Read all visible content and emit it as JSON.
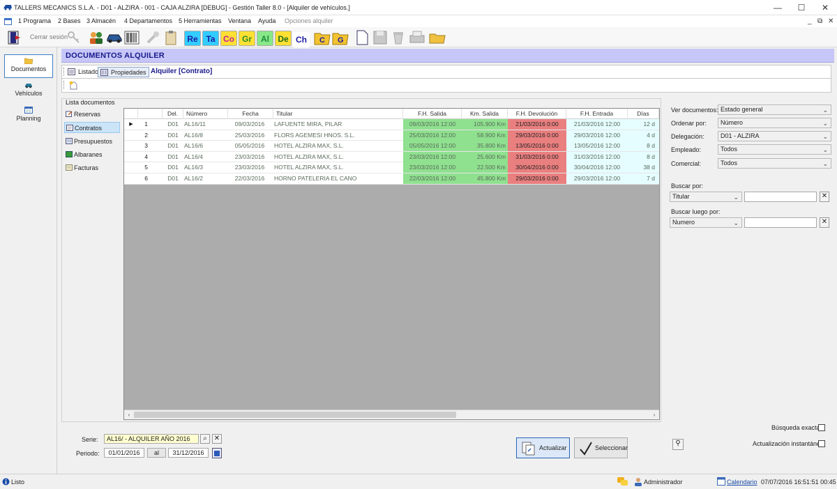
{
  "window": {
    "title": "TALLERS MECANICS S.L.A. - D01 - ALZIRA - 001 - CAJA ALZIRA [DEBUG] - Gestión Taller 8.0 - [Alquiler de vehículos.]",
    "minimize": "—",
    "maximize": "☐",
    "close": "✕"
  },
  "menu": {
    "items": [
      "1 Programa",
      "2 Bases",
      "3 Almacén",
      "4 Departamentos",
      "5 Herramientas",
      "Ventana",
      "Ayuda",
      "Opciones alquiler"
    ],
    "mdi_min": "_",
    "mdi_restore": "⧉",
    "mdi_close": "✕"
  },
  "toolbar": {
    "logout_label": "Cerrar sesión",
    "text_buttons": [
      "Re",
      "Ta",
      "Co",
      "Gr",
      "Al",
      "De",
      "Ch"
    ],
    "text_colors": [
      "#1a1aa0",
      "#1a1aa0",
      "#c81a9a",
      "#2a8a2a",
      "#1a8a3a",
      "#1a6a1a",
      "#1a1aa0"
    ],
    "text_bgs": [
      "#33ccff",
      "#33ccff",
      "#ffe033",
      "#ffe033",
      "#88e888",
      "#ffe033",
      "#ffffff"
    ]
  },
  "nav": {
    "items": [
      {
        "label": "Documentos",
        "icon": "folder-icon"
      },
      {
        "label": "Vehículos",
        "icon": "car-icon"
      },
      {
        "label": "Planning",
        "icon": "calendar-icon"
      }
    ]
  },
  "header": {
    "title": "DOCUMENTOS ALQUILER"
  },
  "tabs": {
    "listado": "Listado",
    "propiedades": "Propiedades",
    "doc_title": "Alquiler [Contrato]"
  },
  "list": {
    "group_label": "Lista documentos",
    "categories": [
      "Reservas",
      "Contratos",
      "Presupuestos",
      "Albaranes",
      "Facturas"
    ]
  },
  "grid": {
    "columns": [
      "Del.",
      "Número",
      "Fecha",
      "Titular",
      "F.H. Salida",
      "Km. Salida",
      "F.H. Devolución",
      "F.H. Entrada",
      "Días"
    ],
    "rows": [
      {
        "n": "1",
        "del": "D01",
        "numero": "AL16/11",
        "fecha": "09/03/2016",
        "titular": "LAFUENTE MIRA, PILAR",
        "fh_salida": "09/03/2016 12:00",
        "km_salida": "105.900 Km",
        "fh_devolucion": "21/03/2016 0:00",
        "fh_entrada": "21/03/2016 12:00",
        "dias": "12 d"
      },
      {
        "n": "2",
        "del": "D01",
        "numero": "AL16/8",
        "fecha": "25/03/2016",
        "titular": "FLORS AGEMESI HNOS. S.L.",
        "fh_salida": "25/03/2016 12:00",
        "km_salida": "58.900 Km",
        "fh_devolucion": "29/03/2016 0:00",
        "fh_entrada": "29/03/2016 12:00",
        "dias": "4 d"
      },
      {
        "n": "3",
        "del": "D01",
        "numero": "AL16/6",
        "fecha": "05/05/2016",
        "titular": "HOTEL ALZIRA MAX, S.L.",
        "fh_salida": "05/05/2016 12:00",
        "km_salida": "35.800 Km",
        "fh_devolucion": "13/05/2016 0:00",
        "fh_entrada": "13/05/2016 12:00",
        "dias": "8 d"
      },
      {
        "n": "4",
        "del": "D01",
        "numero": "AL16/4",
        "fecha": "23/03/2016",
        "titular": "HOTEL ALZIRA MAX, S.L.",
        "fh_salida": "23/03/2016 12:00",
        "km_salida": "25.600 Km",
        "fh_devolucion": "31/03/2016 0:00",
        "fh_entrada": "31/03/2016 12:00",
        "dias": "8 d"
      },
      {
        "n": "5",
        "del": "D01",
        "numero": "AL16/3",
        "fecha": "23/03/2016",
        "titular": "HOTEL ALZIRA MAX, S.L.",
        "fh_salida": "23/03/2016 12:00",
        "km_salida": "22.500 Km",
        "fh_devolucion": "30/04/2016 0:00",
        "fh_entrada": "30/04/2016 12:00",
        "dias": "38 d"
      },
      {
        "n": "6",
        "del": "D01",
        "numero": "AL16/2",
        "fecha": "22/03/2016",
        "titular": "HORNO PATELERIA EL CANO",
        "fh_salida": "22/03/2016 12:00",
        "km_salida": "45.800 Km",
        "fh_devolucion": "29/03/2016 0:00",
        "fh_entrada": "29/03/2016 12:00",
        "dias": "7 d"
      }
    ]
  },
  "filters": {
    "ver_documentos": {
      "label": "Ver documentos:",
      "value": "Estado general"
    },
    "ordenar_por": {
      "label": "Ordenar por:",
      "value": "Número"
    },
    "delegacion": {
      "label": "Delegación:",
      "value": "D01 - ALZIRA"
    },
    "empleado": {
      "label": "Empleado:",
      "value": "Todos"
    },
    "comercial": {
      "label": "Comercial:",
      "value": "Todos"
    },
    "buscar_por": {
      "label": "Buscar por:",
      "value": "Titular",
      "text": ""
    },
    "buscar_luego_por": {
      "label": "Buscar luego por:",
      "value": "Numero",
      "text": ""
    },
    "busqueda_exacta": "Búsqueda exacta.",
    "actualizacion_instantanea": "Actualización instantánea."
  },
  "bottom": {
    "serie_label": "Serie:",
    "serie_value": "AL16/ - ALQUILER AÑO 2016",
    "periodo_label": "Periodo:",
    "periodo_from": "01/01/2016",
    "periodo_al": "al",
    "periodo_to": "31/12/2016",
    "actualizar": "Actualizar",
    "seleccionar": "Seleccionar"
  },
  "status": {
    "left": "Listo",
    "user": "Administrador",
    "calendar_link": "Calendario",
    "datetime": "07/07/2016 16:51:51 00:45"
  }
}
